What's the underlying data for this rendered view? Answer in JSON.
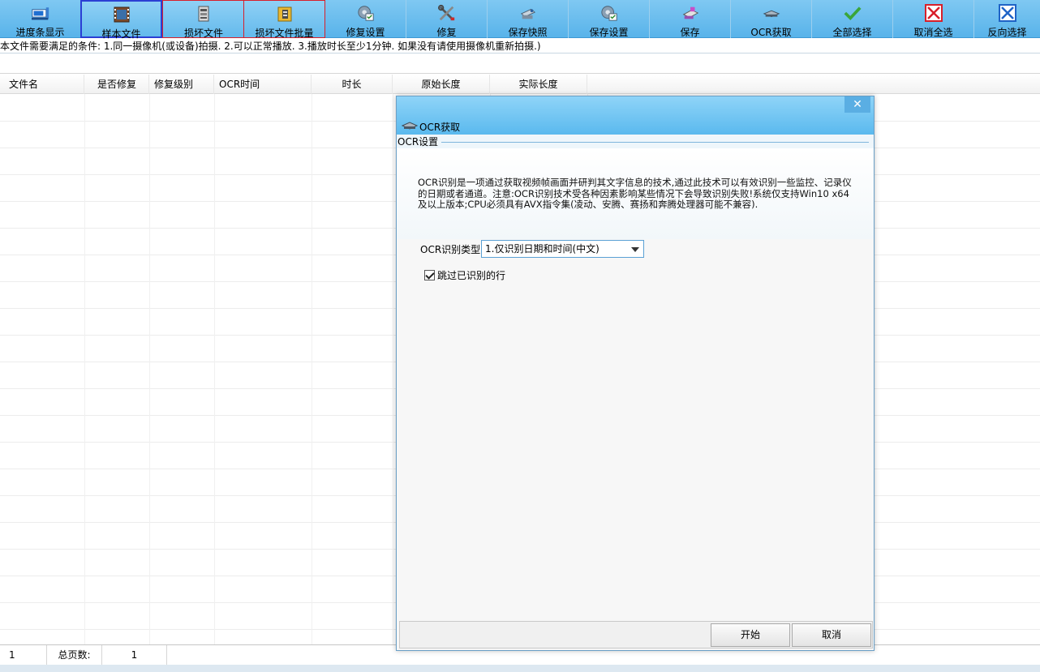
{
  "toolbar": {
    "items": [
      {
        "label": "进度条显示",
        "icon": "progress-display-icon"
      },
      {
        "label": "样本文件",
        "icon": "sample-file-icon"
      },
      {
        "label": "损坏文件",
        "icon": "damaged-file-icon"
      },
      {
        "label": "损坏文件批量",
        "icon": "damaged-batch-icon"
      },
      {
        "label": "修复设置",
        "icon": "repair-settings-icon"
      },
      {
        "label": "修复",
        "icon": "repair-tools-icon"
      },
      {
        "label": "保存快照",
        "icon": "save-snapshot-icon"
      },
      {
        "label": "保存设置",
        "icon": "save-settings-icon"
      },
      {
        "label": "保存",
        "icon": "save-disk-icon"
      },
      {
        "label": "OCR获取",
        "icon": "ocr-scanner-icon"
      },
      {
        "label": "全部选择",
        "icon": "check-all-icon"
      },
      {
        "label": "取消全选",
        "icon": "deselect-all-icon"
      },
      {
        "label": "反向选择",
        "icon": "invert-selection-icon"
      }
    ]
  },
  "info_text": "本文件需要满足的条件: 1.同一摄像机(或设备)拍摄. 2.可以正常播放. 3.播放时长至少1分钟. 如果没有请使用摄像机重新拍摄.)",
  "table": {
    "columns": [
      "文件名",
      "是否修复",
      "修复级别",
      "OCR时间",
      "时长",
      "原始长度",
      "实际长度"
    ]
  },
  "status": {
    "page": "1",
    "total_pages_label": "总页数:",
    "total_pages": "1"
  },
  "dialog": {
    "close_glyph": "✕",
    "title": "OCR获取",
    "group_label": "OCR设置",
    "description": "OCR识别是一项通过获取视频帧画面并研判其文字信息的技术,通过此技术可以有效识别一些监控、记录仪的日期或者通道。注意:OCR识别技术受各种因素影响某些情况下会导致识别失败!系统仅支持Win10 x64 及以上版本;CPU必须具有AVX指令集(凌动、安腾、赛扬和奔腾处理器可能不兼容).",
    "ocr_type_label": "OCR识别类型:",
    "ocr_type_value": "1.仅识别日期和时间(中文)",
    "skip_label": "跳过已识别的行",
    "start_button": "开始",
    "cancel_button": "取消"
  },
  "colors": {
    "toolbar_top": "#7fc8f2",
    "toolbar_bottom": "#58b3ea",
    "selected_blue": "#2b3fd4",
    "selected_red": "#d81f2a"
  }
}
